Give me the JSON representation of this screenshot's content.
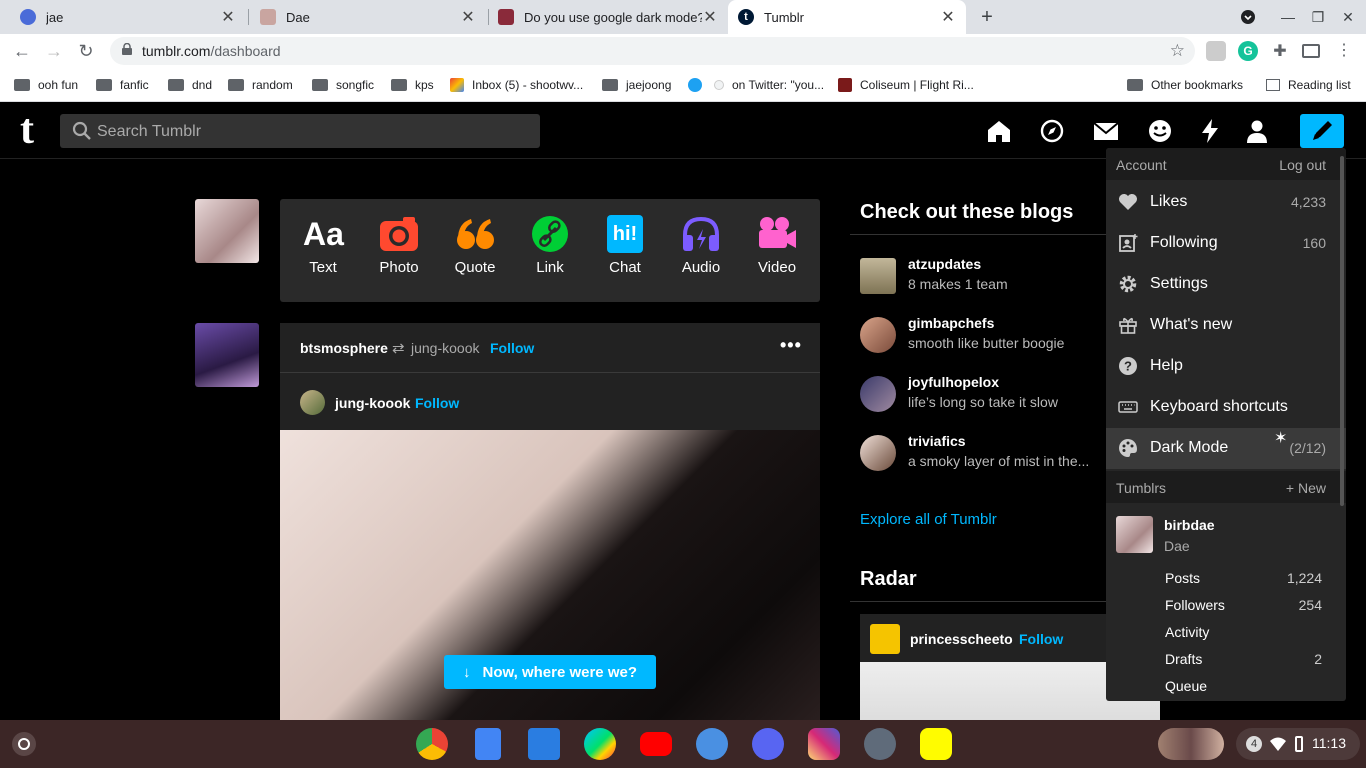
{
  "browser": {
    "tabs": [
      {
        "title": "jae",
        "favicon_color": "#4a6bd8"
      },
      {
        "title": "Dae",
        "favicon_color": "#c9a5a0"
      },
      {
        "title": "Do you use google dark mode? -",
        "favicon_color": "#8a2a3a"
      },
      {
        "title": "Tumblr",
        "favicon_color": "#001935"
      }
    ],
    "new_tab_icon": "plus-icon",
    "url_domain": "tumblr.com",
    "url_path": "/dashboard",
    "bookmarks": [
      {
        "label": "ooh fun",
        "type": "folder"
      },
      {
        "label": "fanfic",
        "type": "folder"
      },
      {
        "label": "dnd",
        "type": "folder"
      },
      {
        "label": "random",
        "type": "folder"
      },
      {
        "label": "songfic",
        "type": "folder"
      },
      {
        "label": "kps",
        "type": "folder"
      },
      {
        "label": "Inbox (5) - shootwv...",
        "type": "gmail"
      },
      {
        "label": "jaejoong",
        "type": "folder"
      },
      {
        "label": "",
        "type": "twitter"
      },
      {
        "label": "on Twitter: \"you...",
        "type": "site"
      },
      {
        "label": "Coliseum | Flight Ri...",
        "type": "site"
      }
    ],
    "other_bookmarks": "Other bookmarks",
    "reading_list": "Reading list"
  },
  "tumblr": {
    "logo": "t",
    "search_placeholder": "Search Tumblr",
    "composer": [
      {
        "label": "Text",
        "glyph": "Aa",
        "color": "#ffffff"
      },
      {
        "label": "Photo",
        "glyph": "",
        "color": "#ff492f"
      },
      {
        "label": "Quote",
        "glyph": "“",
        "color": "#ff8a00"
      },
      {
        "label": "Link",
        "glyph": "",
        "color": "#00cf35"
      },
      {
        "label": "Chat",
        "glyph": "hi!",
        "color": "#00b8ff"
      },
      {
        "label": "Audio",
        "glyph": "",
        "color": "#7c5cff"
      },
      {
        "label": "Video",
        "glyph": "",
        "color": "#ff62ce"
      }
    ],
    "post": {
      "reblogger": "btsmosphere",
      "source": "jung-koook",
      "follow1": "Follow",
      "author": "jung-koook",
      "follow2": "Follow"
    },
    "resume_button": "Now, where were we?",
    "check_out_title": "Check out these blogs",
    "suggested": [
      {
        "name": "atzupdates",
        "desc": "8 makes 1 team"
      },
      {
        "name": "gimbapchefs",
        "desc": "smooth like butter boogie"
      },
      {
        "name": "joyfulhopelox",
        "desc": "life’s long so take it slow"
      },
      {
        "name": "triviafics",
        "desc": "a smoky layer of mist in the..."
      }
    ],
    "explore": "Explore all of Tumblr",
    "radar_title": "Radar",
    "radar_blog": "princesscheeto",
    "radar_follow": "Follow"
  },
  "menu": {
    "account": "Account",
    "logout": "Log out",
    "items": [
      {
        "label": "Likes",
        "count": "4,233",
        "icon": "heart-icon"
      },
      {
        "label": "Following",
        "count": "160",
        "icon": "following-icon"
      },
      {
        "label": "Settings",
        "count": "",
        "icon": "gear-icon"
      },
      {
        "label": "What's new",
        "count": "",
        "icon": "gift-icon"
      },
      {
        "label": "Help",
        "count": "",
        "icon": "help-icon"
      },
      {
        "label": "Keyboard shortcuts",
        "count": "",
        "icon": "keyboard-icon"
      },
      {
        "label": "Dark Mode",
        "count": "(2/12)",
        "icon": "palette-icon"
      }
    ],
    "tumblrs": "Tumblrs",
    "new": "+ New",
    "blog_name": "birbdae",
    "blog_title": "Dae",
    "sub_items": [
      {
        "label": "Posts",
        "count": "1,224"
      },
      {
        "label": "Followers",
        "count": "254"
      },
      {
        "label": "Activity",
        "count": ""
      },
      {
        "label": "Drafts",
        "count": "2"
      },
      {
        "label": "Queue",
        "count": ""
      }
    ]
  },
  "shelf": {
    "notification_count": "4",
    "time": "11:13"
  }
}
